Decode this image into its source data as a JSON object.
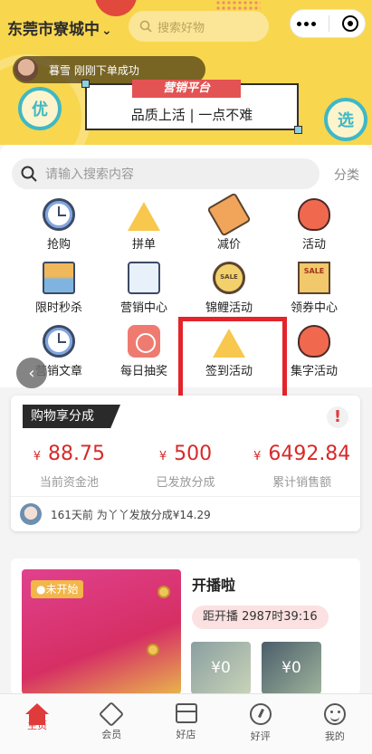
{
  "header": {
    "city": "东莞市寮城中",
    "search_placeholder": "搜索好物",
    "notice": "暮雪 刚刚下单成功"
  },
  "banner": {
    "tag": "营销平台",
    "slogan": "品质上活 | 一点不难",
    "left_bubble": "优",
    "right_bubble": "选"
  },
  "search": {
    "placeholder": "请输入搜索内容",
    "category_label": "分类"
  },
  "grid": [
    {
      "label": "抢购",
      "icon": "clock-icon"
    },
    {
      "label": "拼单",
      "icon": "watermelon-icon"
    },
    {
      "label": "减价",
      "icon": "price-tag-icon"
    },
    {
      "label": "活动",
      "icon": "fire-icon"
    },
    {
      "label": "限时秒杀",
      "icon": "hourglass-icon"
    },
    {
      "label": "营销中心",
      "icon": "phone-icon"
    },
    {
      "label": "锦鲤活动",
      "icon": "sale-medal-icon"
    },
    {
      "label": "领券中心",
      "icon": "coupon-icon"
    },
    {
      "label": "营销文章",
      "icon": "clock-icon"
    },
    {
      "label": "每日抽奖",
      "icon": "lottery-icon"
    },
    {
      "label": "签到活动",
      "icon": "watermelon-icon"
    },
    {
      "label": "集字活动",
      "icon": "fire-icon"
    }
  ],
  "share": {
    "title": "购物享分成",
    "alert": "!",
    "currency": "¥",
    "stats": [
      {
        "value": "88.75",
        "label": "当前资金池"
      },
      {
        "value": "500",
        "label": "已发放分成"
      },
      {
        "value": "6492.84",
        "label": "累计销售额"
      }
    ],
    "log": "161天前 为丫丫发放分成¥14.29"
  },
  "live": {
    "status": "●未开始",
    "title": "开播啦",
    "countdown": "距开播 2987时39:16",
    "thumbs": [
      "¥0",
      "¥0"
    ]
  },
  "tabs": [
    {
      "label": "主页",
      "icon": "home-icon",
      "active": true
    },
    {
      "label": "会员",
      "icon": "diamond-icon",
      "active": false
    },
    {
      "label": "好店",
      "icon": "shop-icon",
      "active": false
    },
    {
      "label": "好评",
      "icon": "review-icon",
      "active": false
    },
    {
      "label": "我的",
      "icon": "smile-icon",
      "active": false
    }
  ],
  "colors": {
    "brand_yellow": "#f8d64e",
    "accent_red": "#e03b3b",
    "price_red": "#d72a2a"
  }
}
